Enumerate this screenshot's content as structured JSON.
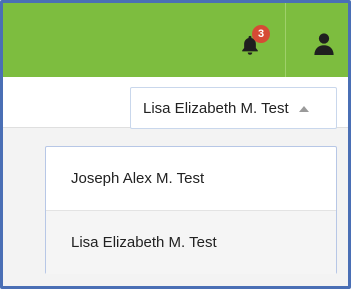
{
  "header": {
    "notification": {
      "icon": "bell-icon",
      "count": "3",
      "badge_color": "#d64b35"
    },
    "user_icon": "user-icon",
    "accent_color": "#7dbd3f"
  },
  "user_selector": {
    "selected": "Lisa Elizabeth M. Test",
    "caret_icon": "caret-up-icon",
    "options": [
      {
        "label": "Joseph Alex M. Test"
      },
      {
        "label": "Lisa Elizabeth M. Test"
      }
    ]
  }
}
